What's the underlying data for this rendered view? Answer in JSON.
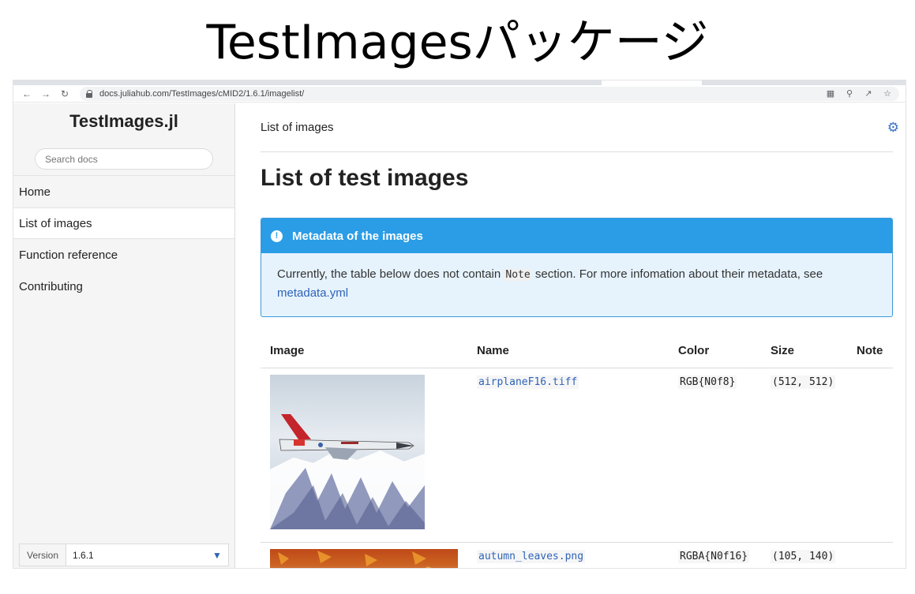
{
  "slide": {
    "title": "TestImagesパッケージ"
  },
  "browser": {
    "url": "docs.juliahub.com/TestImages/cMID2/1.6.1/imagelist/",
    "icons": {
      "back": "back-arrow-icon",
      "forward": "forward-arrow-icon",
      "reload": "reload-icon",
      "translate": "translate-icon",
      "zoom": "zoom-icon",
      "share": "share-icon",
      "bookmark": "star-icon"
    }
  },
  "sidebar": {
    "title": "TestImages.jl",
    "search_placeholder": "Search docs",
    "items": [
      {
        "label": "Home",
        "active": false
      },
      {
        "label": "List of images",
        "active": true
      },
      {
        "label": "Function reference",
        "active": false
      },
      {
        "label": "Contributing",
        "active": false
      }
    ],
    "version": {
      "label": "Version",
      "value": "1.6.1"
    }
  },
  "main": {
    "breadcrumb": "List of images",
    "title": "List of test images",
    "admonition": {
      "title": "Metadata of the images",
      "text_before": "Currently, the table below does not contain ",
      "code": "Note",
      "text_after": " section. For more infomation about their metadata, see ",
      "link": "metadata.yml",
      "color": "#2a9de6"
    },
    "table": {
      "headers": [
        "Image",
        "Name",
        "Color",
        "Size",
        "Note"
      ],
      "rows": [
        {
          "name": "airplaneF16.tiff",
          "color": "RGB{N0f8}",
          "size": "(512, 512)",
          "note": ""
        },
        {
          "name": "autumn_leaves.png",
          "color": "RGBA{N0f16}",
          "size": "(105, 140)",
          "note": ""
        }
      ]
    }
  }
}
